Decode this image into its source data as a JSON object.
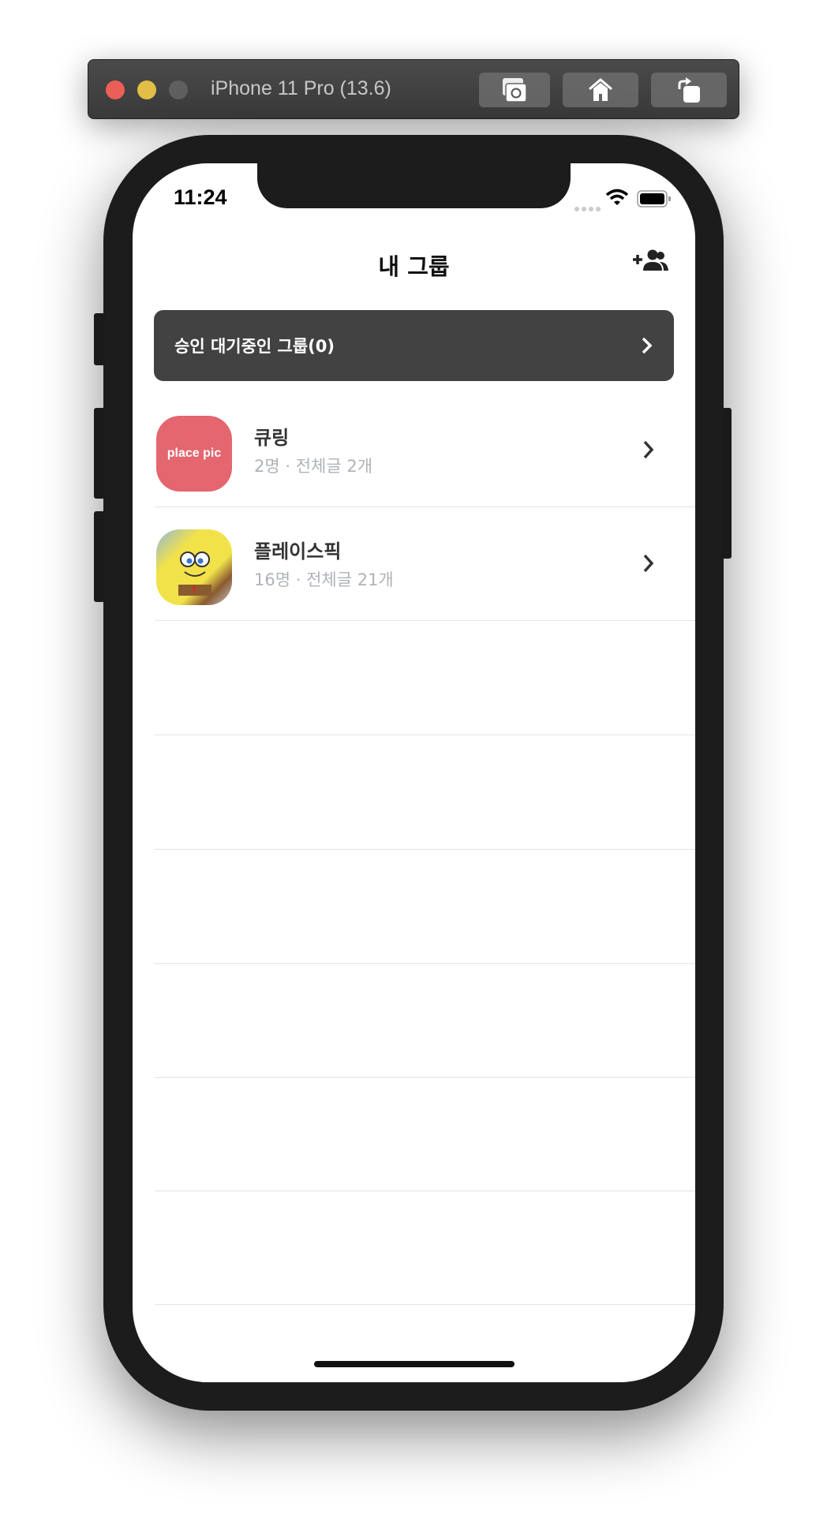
{
  "simulator": {
    "title": "iPhone 11 Pro (13.6)",
    "buttons": [
      {
        "icon": "screenshot-icon"
      },
      {
        "icon": "home-icon"
      },
      {
        "icon": "rotate-icon"
      }
    ]
  },
  "status_bar": {
    "time": "11:24"
  },
  "header": {
    "title": "내 그룹",
    "action_icon": "add-user-icon"
  },
  "pending": {
    "label": "승인 대기중인 그룹(0)"
  },
  "groups": [
    {
      "name": "큐링",
      "meta": "2명 · 전체글 2개",
      "avatar_text": "place pic",
      "avatar_color": "#e4666f"
    },
    {
      "name": "플레이스픽",
      "meta": "16명 · 전체글 21개",
      "avatar_color": "#f2e24a"
    }
  ],
  "colors": {
    "banner": "#424242",
    "meta_text": "#aeb3b9"
  }
}
